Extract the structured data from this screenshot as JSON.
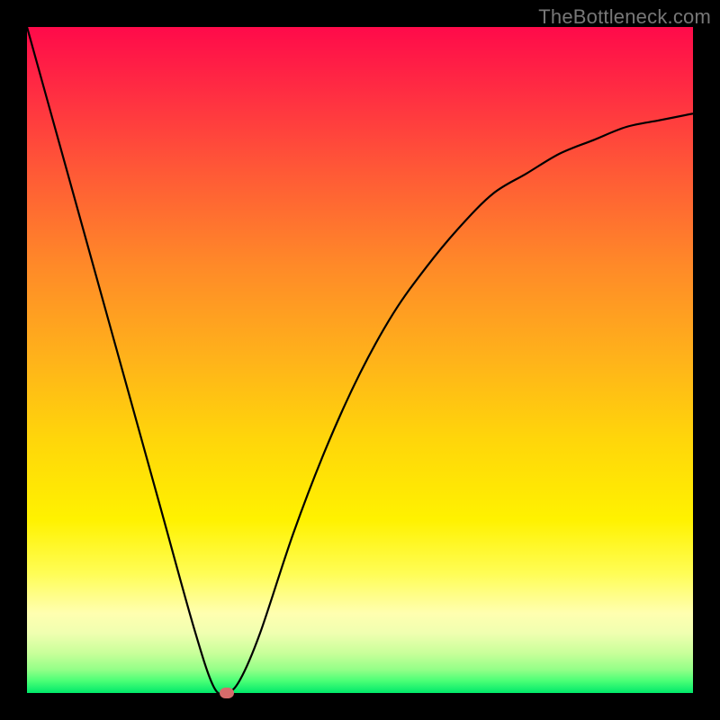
{
  "watermark": "TheBottleneck.com",
  "colors": {
    "background": "#000000",
    "curve": "#000000",
    "marker": "#d66b6b"
  },
  "chart_data": {
    "type": "line",
    "title": "",
    "xlabel": "",
    "ylabel": "",
    "xlim": [
      0,
      100
    ],
    "ylim": [
      0,
      100
    ],
    "grid": false,
    "legend": false,
    "series": [
      {
        "name": "bottleneck-curve",
        "x": [
          0,
          5,
          10,
          15,
          20,
          25,
          28,
          30,
          32,
          35,
          40,
          45,
          50,
          55,
          60,
          65,
          70,
          75,
          80,
          85,
          90,
          95,
          100
        ],
        "y": [
          100,
          82,
          64,
          46,
          28,
          10,
          1,
          0,
          2,
          9,
          24,
          37,
          48,
          57,
          64,
          70,
          75,
          78,
          81,
          83,
          85,
          86,
          87
        ]
      }
    ],
    "markers": [
      {
        "name": "minimum-point",
        "x": 30,
        "y": 0
      }
    ],
    "notes": "Values estimated from pixels; x and y are percent of plot width/height with y increasing upward."
  }
}
